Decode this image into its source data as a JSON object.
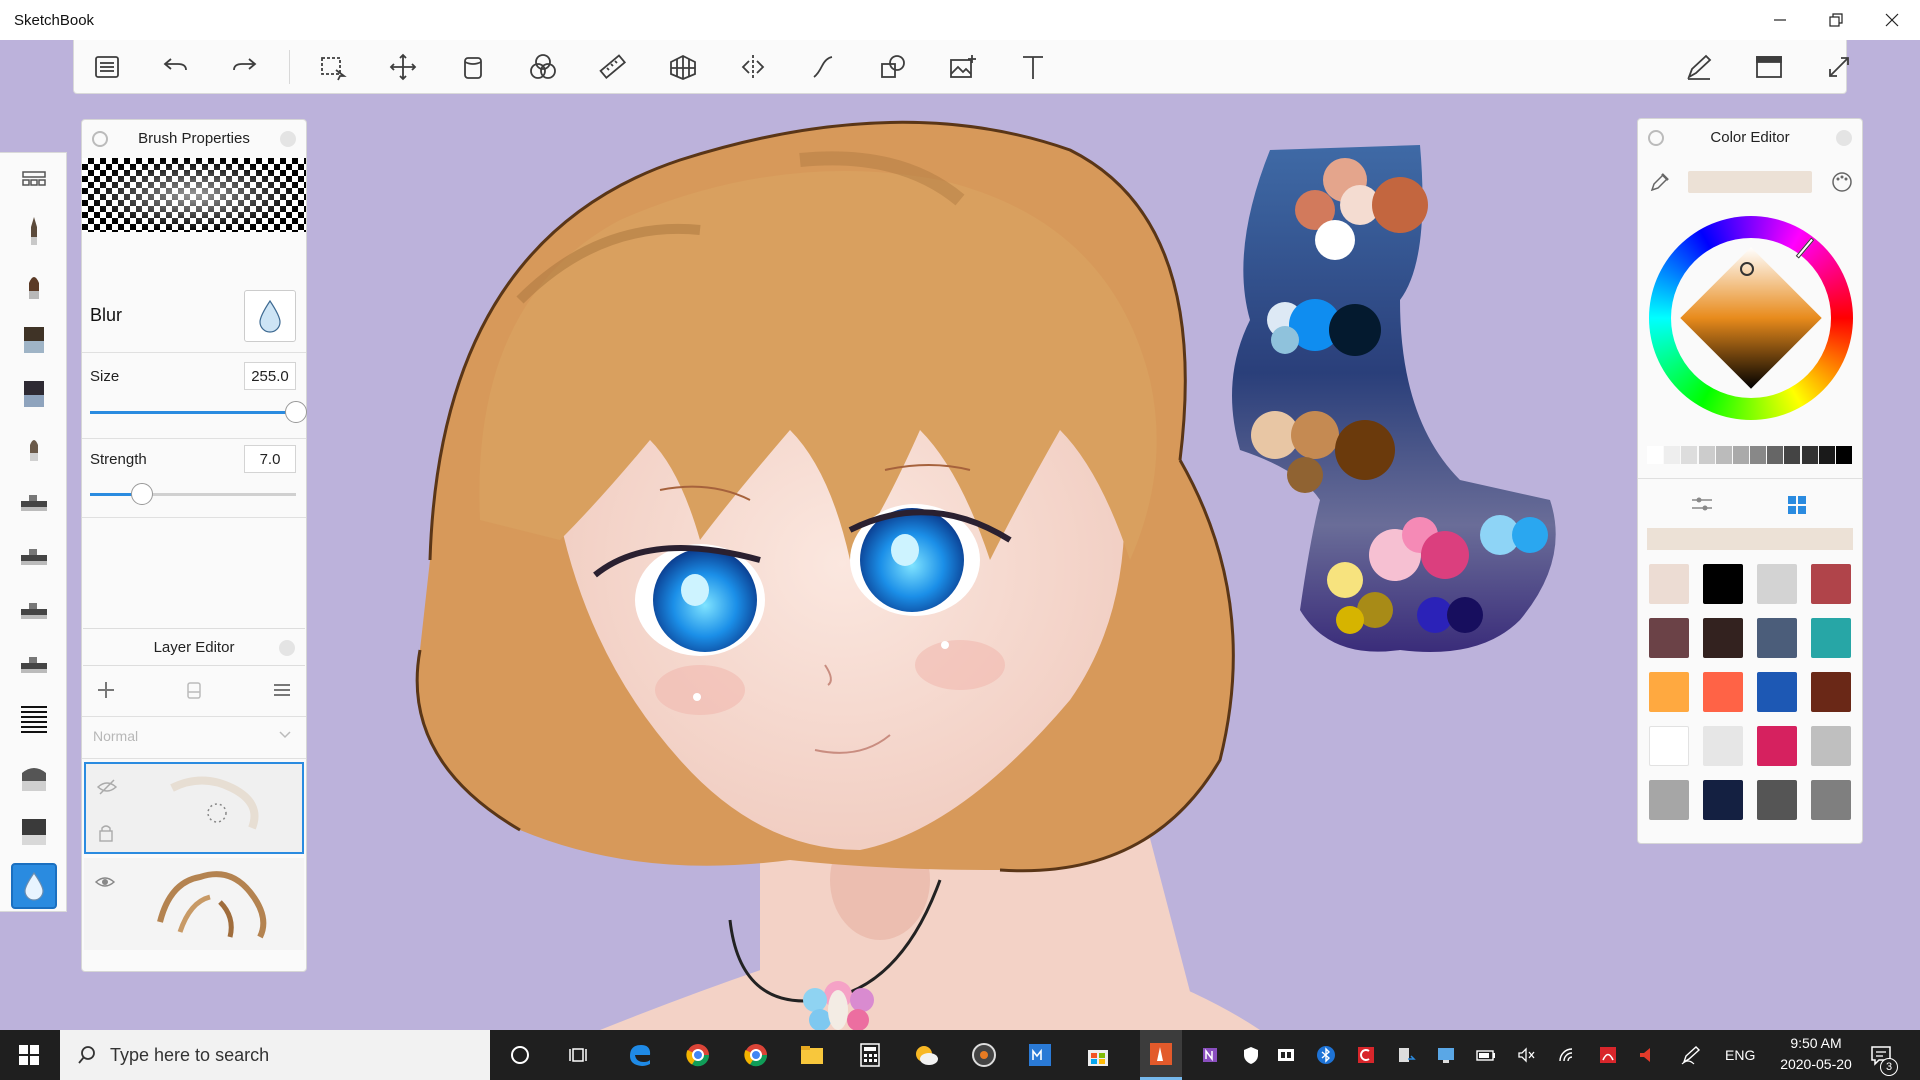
{
  "window": {
    "title": "SketchBook"
  },
  "brush_panel": {
    "title": "Brush Properties",
    "brush_name": "Blur",
    "size_label": "Size",
    "size_value": "255.0",
    "size_fraction": 1.0,
    "strength_label": "Strength",
    "strength_value": "7.0",
    "strength_fraction": 0.25
  },
  "layer_panel": {
    "title": "Layer Editor",
    "blend_mode": "Normal"
  },
  "color_panel": {
    "title": "Color Editor",
    "current_color": "#ece1d6",
    "swatches": [
      "#ecdcd3",
      "#000000",
      "#d3d3d3",
      "#b0444a",
      "#6b4247",
      "#33221f",
      "#4b5d7a",
      "#27a6a6",
      "#ffa940",
      "#ff6346",
      "#1d58b4",
      "#6a2817",
      "#ffffff",
      "#e6e6e6",
      "#d6215f",
      "#bfbfbf",
      "#a6a6a6",
      "#142041",
      "#555555",
      "#7f7f7f"
    ],
    "grays": [
      "#ffffff",
      "#eeeeee",
      "#dddddd",
      "#cccccc",
      "#bbbbbb",
      "#aaaaaa",
      "#888888",
      "#666666",
      "#444444",
      "#333333",
      "#1a1a1a",
      "#000000"
    ]
  },
  "taskbar": {
    "search_placeholder": "Type here to search",
    "language": "ENG",
    "time": "9:50 AM",
    "date": "2020-05-20",
    "notification_count": "3"
  }
}
